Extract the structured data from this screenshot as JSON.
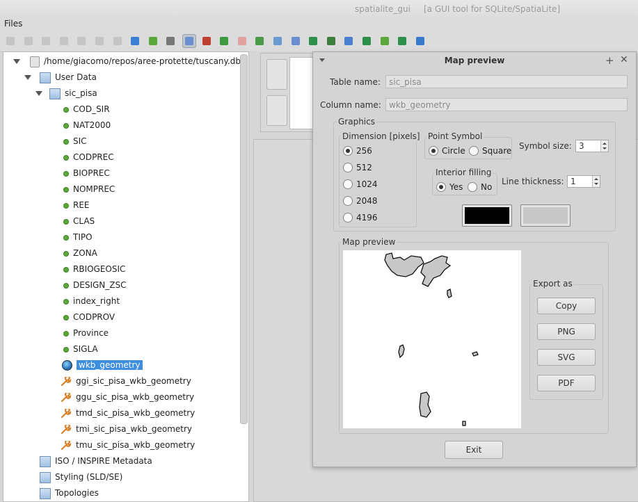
{
  "window": {
    "title": "spatialite_gui     [a GUI tool for SQLite/SpatiaLite]"
  },
  "menu": {
    "files": "Files"
  },
  "toolbar": {
    "icons": [
      "connect-icon",
      "disconnect-icon",
      "create-db-icon",
      "memory-db-icon",
      "vacuum-icon",
      "sql-script-icon",
      "load-shp-icon",
      "virtual-shp-icon",
      "virtual-csv-icon",
      "virtual-dbf-icon",
      "network-icon",
      "exif-icon",
      "gps-icon",
      "wfs-icon",
      "dxf-icon",
      "xml-icon",
      "map-preview-icon",
      "charset-icon",
      "check-geometry-icon",
      "sanitize-icon",
      "attach-db-icon",
      "sql-log-icon",
      "help-icon",
      "exit-icon"
    ]
  },
  "tree": {
    "db_path": "/home/giacomo/repos/aree-protette/tuscany.db",
    "user_data": "User Data",
    "table": "sic_pisa",
    "columns": [
      "COD_SIR",
      "NAT2000",
      "SIC",
      "CODPREC",
      "BIOPREC",
      "NOMPREC",
      "REE",
      "CLAS",
      "TIPO",
      "ZONA",
      "RBIOGEOSIC",
      "DESIGN_ZSC",
      "index_right",
      "CODPROV",
      "Province",
      "SIGLA"
    ],
    "geometry_column": "wkb_geometry",
    "triggers": [
      "ggi_sic_pisa_wkb_geometry",
      "ggu_sic_pisa_wkb_geometry",
      "tmd_sic_pisa_wkb_geometry",
      "tmi_sic_pisa_wkb_geometry",
      "tmu_sic_pisa_wkb_geometry"
    ],
    "other": [
      "ISO / INSPIRE Metadata",
      "Styling (SLD/SE)",
      "Topologies"
    ]
  },
  "dialog": {
    "title": "Map preview",
    "table_name_label": "Table name:",
    "table_name_value": "sic_pisa",
    "column_name_label": "Column name:",
    "column_name_value": "wkb_geometry",
    "graphics_label": "Graphics",
    "dimension_label": "Dimension [pixels]",
    "dimensions": [
      "256",
      "512",
      "1024",
      "2048",
      "4196"
    ],
    "dimension_selected": "256",
    "point_symbol_label": "Point Symbol",
    "circle_label": "Circle",
    "square_label": "Square",
    "point_symbol_selected": "Circle",
    "symbol_size_label": "Symbol size:",
    "symbol_size_value": "3",
    "interior_filling_label": "Interior filling",
    "yes_label": "Yes",
    "no_label": "No",
    "interior_filling_selected": "Yes",
    "line_thickness_label": "Line thickness:",
    "line_thickness_value": "1",
    "line_color": "#000000",
    "fill_color": "#c8c8c8",
    "map_preview_label": "Map preview",
    "export_as_label": "Export as",
    "export_buttons": [
      "Copy",
      "PNG",
      "SVG",
      "PDF"
    ],
    "exit_label": "Exit"
  }
}
